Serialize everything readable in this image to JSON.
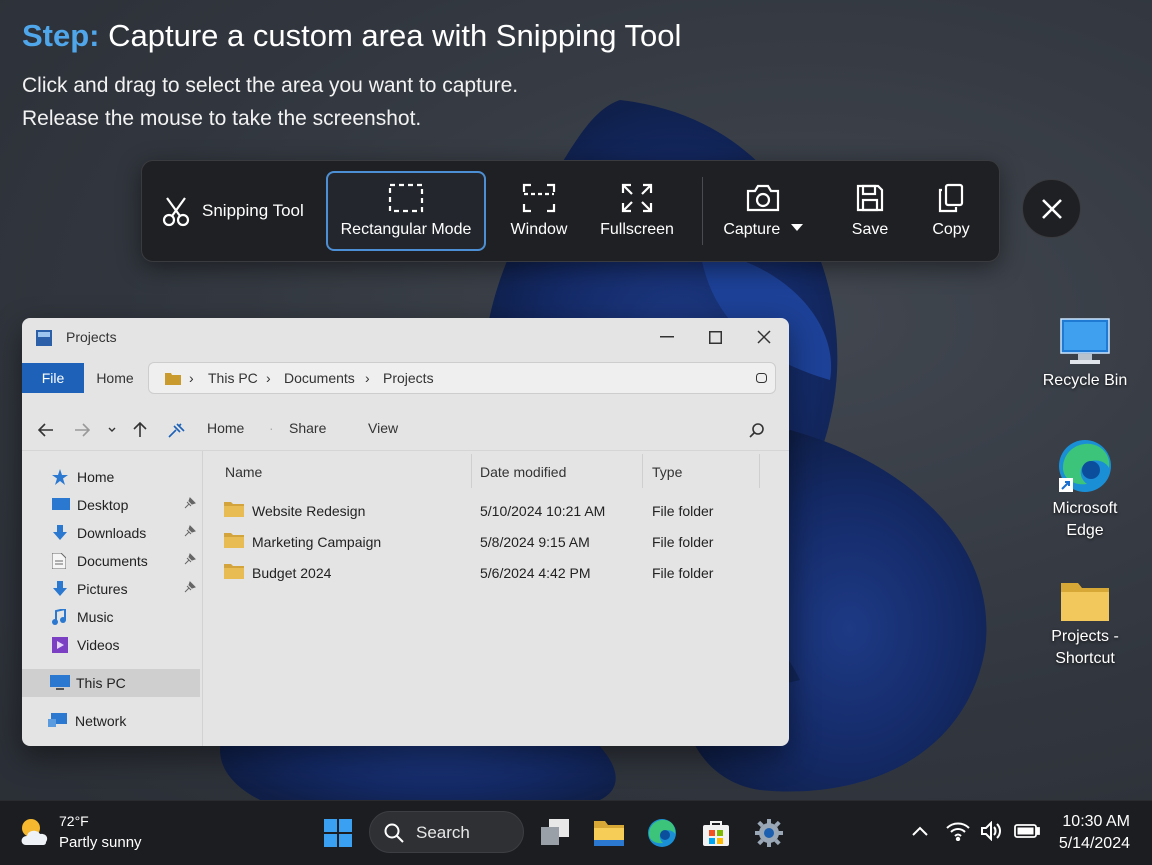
{
  "instruction": {
    "step_label": "Step:",
    "title": "Capture a custom area with Snipping Tool",
    "line1": "Click and drag to select the area you want to capture.",
    "line2": "Release the mouse to take the screenshot."
  },
  "snipping_toolbar": {
    "app_name": "Snipping Tool",
    "modes": [
      {
        "label": "Rectangular Mode",
        "icon": "rectangle-selection-icon",
        "active": true
      },
      {
        "label": "Window",
        "icon": "window-selection-icon",
        "active": false
      },
      {
        "label": "Fullscreen",
        "icon": "fullscreen-icon",
        "active": false
      }
    ],
    "capture_label": "Capture",
    "save_label": "Save",
    "copy_label": "Copy",
    "accent_color": "#4d8fd4"
  },
  "explorer": {
    "title": "Projects",
    "file_tab": "File",
    "home_tab": "Home",
    "breadcrumb": [
      "This PC",
      "Documents",
      "Projects"
    ],
    "commands": {
      "home": "Home",
      "share": "Share",
      "view": "View"
    },
    "nav_items": [
      {
        "label": "Home",
        "icon": "star-icon",
        "pinned": false
      },
      {
        "label": "Desktop",
        "icon": "desktop-icon",
        "pinned": true
      },
      {
        "label": "Downloads",
        "icon": "download-icon",
        "pinned": true
      },
      {
        "label": "Documents",
        "icon": "document-icon",
        "pinned": true
      },
      {
        "label": "Pictures",
        "icon": "pictures-icon",
        "pinned": true
      },
      {
        "label": "Music",
        "icon": "music-icon",
        "pinned": false
      },
      {
        "label": "Videos",
        "icon": "video-icon",
        "pinned": false
      },
      {
        "label": "This PC",
        "icon": "computer-icon",
        "selected": true
      },
      {
        "label": "Network",
        "icon": "network-icon"
      }
    ],
    "columns": [
      "Name",
      "Date modified",
      "Type"
    ],
    "files": [
      {
        "name": "Website Redesign",
        "date": "5/10/2024 10:21 AM",
        "type": "File folder"
      },
      {
        "name": "Marketing Campaign",
        "date": "5/8/2024 9:15 AM",
        "type": "File folder"
      },
      {
        "name": "Budget 2024",
        "date": "5/6/2024 4:42 PM",
        "type": "File folder"
      }
    ]
  },
  "desktop_icons": {
    "recycle_bin": "Recycle Bin",
    "edge_line1": "Microsoft",
    "edge_line2": "Edge",
    "projects_line1": "Projects -",
    "projects_line2": "Shortcut"
  },
  "taskbar": {
    "weather_temp": "72°F",
    "weather_desc": "Partly sunny",
    "search_label": "Search",
    "time": "10:30 AM",
    "date": "5/14/2024"
  }
}
